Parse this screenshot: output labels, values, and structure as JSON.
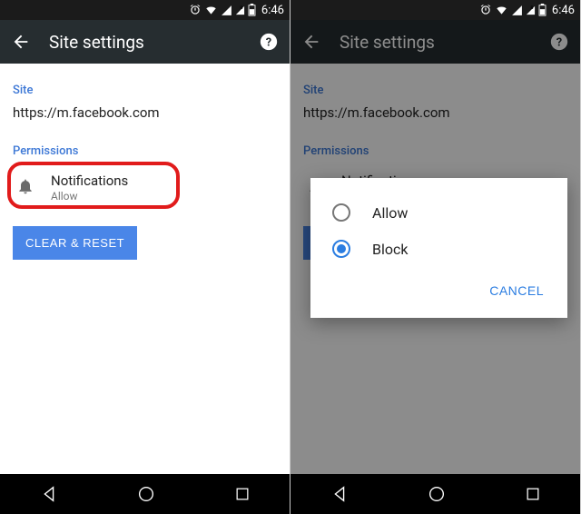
{
  "status": {
    "time": "6:46"
  },
  "app": {
    "title": "Site settings"
  },
  "site": {
    "label": "Site",
    "url": "https://m.facebook.com"
  },
  "permissions": {
    "label": "Permissions",
    "notification": {
      "title": "Notifications",
      "status": "Allow"
    }
  },
  "buttons": {
    "clear": "CLEAR & RESET"
  },
  "dialog": {
    "option_allow": "Allow",
    "option_block": "Block",
    "cancel": "CANCEL"
  }
}
